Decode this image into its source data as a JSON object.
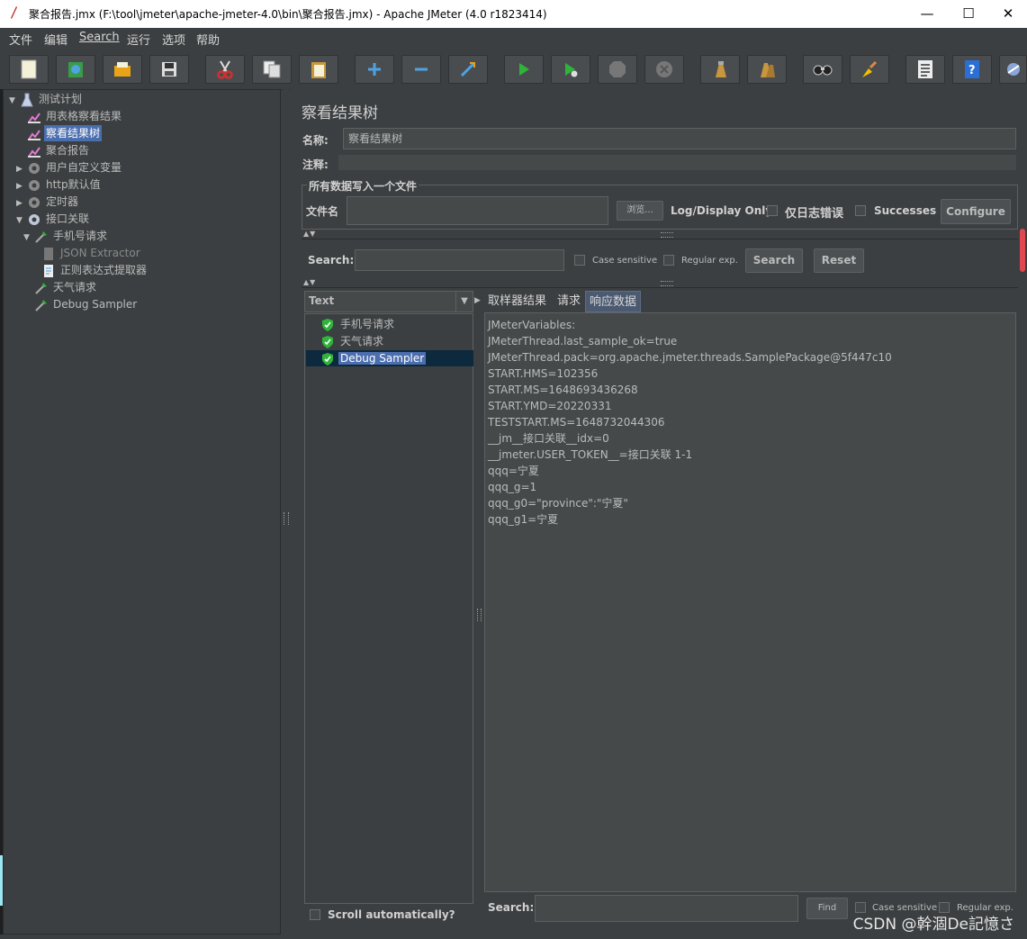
{
  "window": {
    "title": "聚合报告.jmx (F:\\tool\\jmeter\\apache-jmeter-4.0\\bin\\聚合报告.jmx) - Apache JMeter (4.0 r1823414)",
    "minimize": "—",
    "maximize": "☐",
    "close": "✕"
  },
  "menu": [
    "文件",
    "编辑",
    "Search",
    "运行",
    "选项",
    "帮助"
  ],
  "toolbar": [
    "new-icon",
    "templates-icon",
    "open-icon",
    "save-icon",
    "cut-icon",
    "copy-icon",
    "paste-icon",
    "expand-icon",
    "collapse-icon",
    "toggle-icon",
    "start-icon",
    "start-no-pause-icon",
    "stop-icon",
    "shutdown-icon",
    "clear-icon",
    "clear-all-icon",
    "search-icon",
    "reset-search-icon",
    "function-helper-icon",
    "help-icon",
    "remote-icon"
  ],
  "tree": [
    {
      "label": "测试计划",
      "level": 0,
      "toggle": "▼",
      "icon": "test-plan-icon"
    },
    {
      "label": "用表格察看结果",
      "level": 1,
      "toggle": "",
      "icon": "listener-icon"
    },
    {
      "label": "察看结果树",
      "level": 1,
      "toggle": "",
      "icon": "listener-icon",
      "selected": true
    },
    {
      "label": "聚合报告",
      "level": 1,
      "toggle": "",
      "icon": "listener-icon"
    },
    {
      "label": "用户自定义变量",
      "level": 1,
      "toggle": "▶",
      "icon": "gear-icon"
    },
    {
      "label": "http默认值",
      "level": 1,
      "toggle": "▶",
      "icon": "gear-icon"
    },
    {
      "label": "定时器",
      "level": 1,
      "toggle": "▶",
      "icon": "gear-icon"
    },
    {
      "label": "接口关联",
      "level": 1,
      "toggle": "▼",
      "icon": "gear-icon"
    },
    {
      "label": "手机号请求",
      "level": 2,
      "toggle": "▼",
      "icon": "sampler-icon"
    },
    {
      "label": "JSON Extractor",
      "level": 3,
      "toggle": "",
      "icon": "extractor-icon",
      "disabled": true
    },
    {
      "label": "正则表达式提取器",
      "level": 3,
      "toggle": "",
      "icon": "extractor-icon"
    },
    {
      "label": "天气请求",
      "level": 2,
      "toggle": "",
      "icon": "sampler-icon"
    },
    {
      "label": "Debug Sampler",
      "level": 2,
      "toggle": "",
      "icon": "sampler-icon"
    }
  ],
  "panel": {
    "title": "察看结果树",
    "name_label": "名称:",
    "name_value": "察看结果树",
    "comment_label": "注释:",
    "file_group_title": "所有数据写入一个文件",
    "filename_label": "文件名",
    "browse": "浏览...",
    "log_display_only": "Log/Display Only:",
    "errors_only": "仅日志错误",
    "successes": "Successes",
    "configure": "Configure",
    "search_label": "Search:",
    "case_sensitive": "Case sensitive",
    "regular_exp": "Regular exp.",
    "search_button": "Search",
    "reset_button": "Reset"
  },
  "results": {
    "renderer": "Text",
    "items": [
      {
        "label": "手机号请求",
        "selected": false
      },
      {
        "label": "天气请求",
        "selected": false
      },
      {
        "label": "Debug Sampler",
        "selected": true
      }
    ],
    "scroll_auto": "Scroll automatically?"
  },
  "tabs": [
    {
      "label": "取样器结果",
      "active": false
    },
    {
      "label": "请求",
      "active": false
    },
    {
      "label": "响应数据",
      "active": true
    }
  ],
  "response_lines": [
    "JMeterVariables:",
    "JMeterThread.last_sample_ok=true",
    "JMeterThread.pack=org.apache.jmeter.threads.SamplePackage@5f447c10",
    "START.HMS=102356",
    "START.MS=1648693436268",
    "START.YMD=20220331",
    "TESTSTART.MS=1648732044306",
    "__jm__接口关联__idx=0",
    "__jmeter.USER_TOKEN__=接口关联 1-1",
    "qqq=宁夏",
    "qqq_g=1",
    "qqq_g0=\"province\":\"宁夏\"",
    "qqq_g1=宁夏"
  ],
  "bottom_search": {
    "label": "Search:",
    "find": "Find",
    "case_sensitive": "Case sensitive",
    "regular_exp": "Regular exp."
  },
  "watermark": "CSDN @幹涸De記憶さ"
}
